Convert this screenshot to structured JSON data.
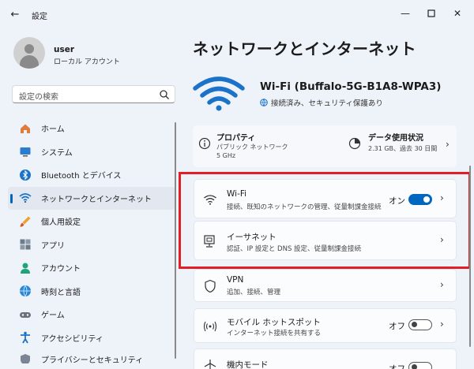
{
  "window": {
    "title": "設定"
  },
  "user": {
    "name": "user",
    "account_type": "ローカル アカウント"
  },
  "search": {
    "placeholder": "設定の検索"
  },
  "sidebar": {
    "items": [
      {
        "label": "ホーム",
        "icon": "home-icon"
      },
      {
        "label": "システム",
        "icon": "system-icon"
      },
      {
        "label": "Bluetooth とデバイス",
        "icon": "bluetooth-icon"
      },
      {
        "label": "ネットワークとインターネット",
        "icon": "network-icon",
        "active": true
      },
      {
        "label": "個人用設定",
        "icon": "brush-icon"
      },
      {
        "label": "アプリ",
        "icon": "apps-icon"
      },
      {
        "label": "アカウント",
        "icon": "account-icon"
      },
      {
        "label": "時刻と言語",
        "icon": "time-language-icon"
      },
      {
        "label": "ゲーム",
        "icon": "gaming-icon"
      },
      {
        "label": "アクセシビリティ",
        "icon": "accessibility-icon"
      },
      {
        "label": "プライバシーとセキュリティ",
        "icon": "privacy-icon"
      }
    ]
  },
  "main": {
    "title": "ネットワークとインターネット",
    "network": {
      "name": "Wi-Fi (Buffalo-5G-B1A8-WPA3)",
      "status": "接続済み、セキュリティ保護あり"
    },
    "properties": {
      "title": "プロパティ",
      "line1": "パブリック ネットワーク",
      "line2": "5 GHz"
    },
    "data_usage": {
      "title": "データ使用状況",
      "detail": "2.31 GB、過去 30 日間"
    },
    "rows": {
      "wifi": {
        "title": "Wi-Fi",
        "subtitle": "接続、既知のネットワークの管理、従量制課金接続",
        "state": "オン"
      },
      "ethernet": {
        "title": "イーサネット",
        "subtitle": "認証、IP 設定と DNS 設定、従量制課金接続"
      },
      "vpn": {
        "title": "VPN",
        "subtitle": "追加、接続、管理"
      },
      "hotspot": {
        "title": "モバイル ホットスポット",
        "subtitle": "インターネット接続を共有する",
        "state": "オフ"
      },
      "airplane": {
        "title": "機内モード",
        "state": "オフ"
      }
    }
  },
  "colors": {
    "accent": "#0067c0",
    "highlight": "#e41e26",
    "background": "#eef2f9"
  }
}
